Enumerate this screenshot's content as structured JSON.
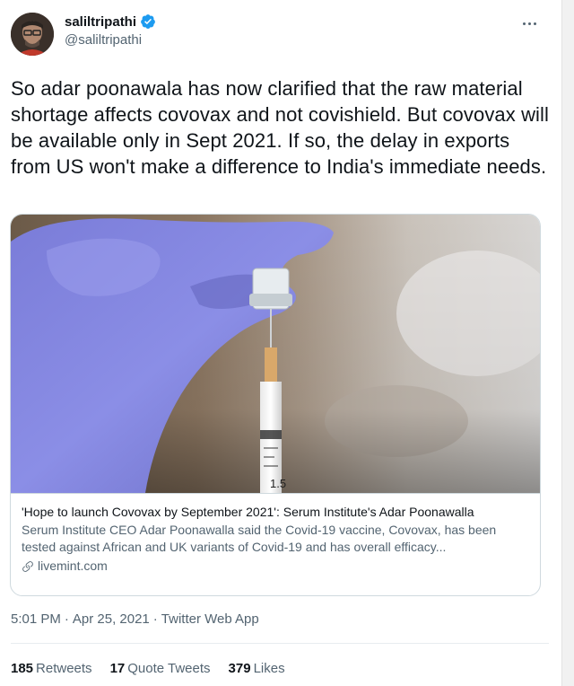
{
  "author": {
    "display_name": "saliltripathi",
    "handle": "@saliltripathi",
    "verified": true
  },
  "tweet": {
    "text": "So adar poonawala has now clarified that the raw material shortage affects covovax and not covishield. But covovax will be available only in Sept 2021. If so, the delay in exports from US won't make a difference to India's immediate needs."
  },
  "card": {
    "title": "'Hope to launch Covovax by September 2021': Serum Institute's Adar Poonawalla",
    "description": "Serum Institute CEO Adar Poonawalla said the Covid-19 vaccine, Covovax, has been tested against African and UK variants of Covid-19 and has overall efficacy...",
    "domain": "livemint.com",
    "image_syringe_label": "1.5"
  },
  "meta": {
    "time": "5:01 PM",
    "separator": "·",
    "date": "Apr 25, 2021",
    "source": "Twitter Web App"
  },
  "stats": {
    "retweets_count": "185",
    "retweets_label": "Retweets",
    "quote_tweets_count": "17",
    "quote_tweets_label": "Quote Tweets",
    "likes_count": "379",
    "likes_label": "Likes"
  },
  "icons": {
    "verified": "verified-badge-icon",
    "more": "more-options-icon",
    "link": "link-icon"
  },
  "colors": {
    "verified_blue": "#1d9bf0",
    "secondary_text": "#536471",
    "border": "#cfd9de"
  }
}
